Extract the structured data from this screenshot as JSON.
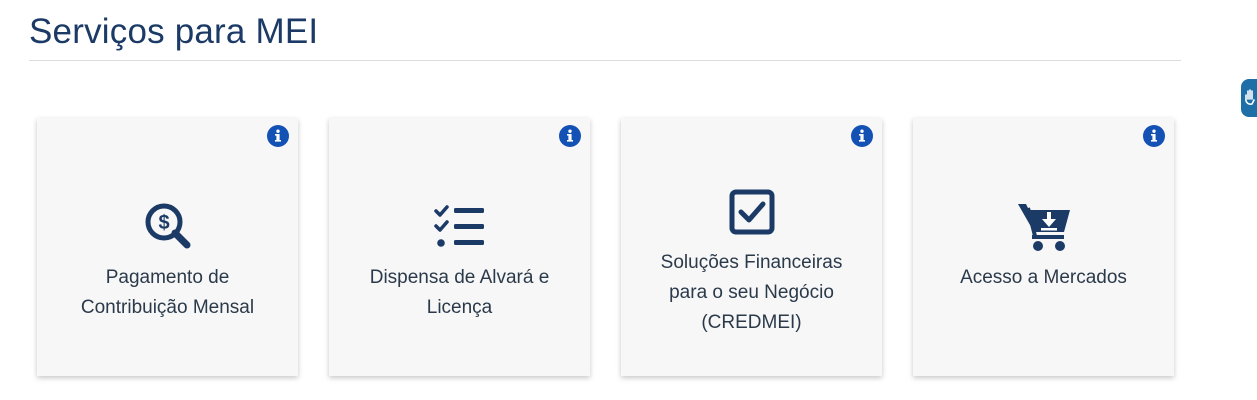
{
  "page": {
    "title": "Serviços para MEI"
  },
  "colors": {
    "title": "#1b3a66",
    "icon": "#1b3a66",
    "info_badge": "#1351b4",
    "card_bg": "#f7f7f7",
    "side_tab": "#1e6fa8"
  },
  "cards": [
    {
      "icon": "dollar-search-icon",
      "label_lines": [
        "Pagamento de",
        "Contribuição Mensal"
      ]
    },
    {
      "icon": "checklist-icon",
      "label_lines": [
        "Dispensa de Alvará e",
        "Licença"
      ]
    },
    {
      "icon": "checkbox-checked-icon",
      "label_lines": [
        "Soluções Financeiras",
        "para o seu Negócio",
        "(CREDMEI)"
      ]
    },
    {
      "icon": "shopping-cart-download-icon",
      "label_lines": [
        "Acesso a Mercados"
      ]
    }
  ],
  "info_icon": "info-icon",
  "side_tab_icon": "hand-sign-language-icon"
}
